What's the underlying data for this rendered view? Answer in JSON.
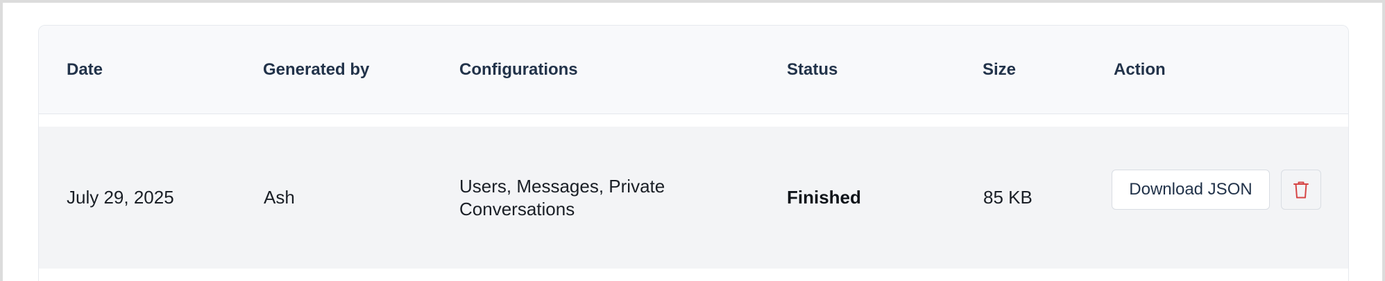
{
  "table": {
    "headers": {
      "date": "Date",
      "generated_by": "Generated by",
      "configurations": "Configurations",
      "status": "Status",
      "size": "Size",
      "action": "Action"
    },
    "rows": [
      {
        "date": "July 29, 2025",
        "generated_by": "Ash",
        "configurations": "Users, Messages, Private Conversations",
        "status": "Finished",
        "size": "85 KB",
        "download_label": "Download JSON",
        "delete_icon": "trash-icon"
      }
    ]
  },
  "colors": {
    "delete_icon": "#d64545",
    "header_bg": "#f8f9fb",
    "row_bg": "#f3f4f6"
  }
}
